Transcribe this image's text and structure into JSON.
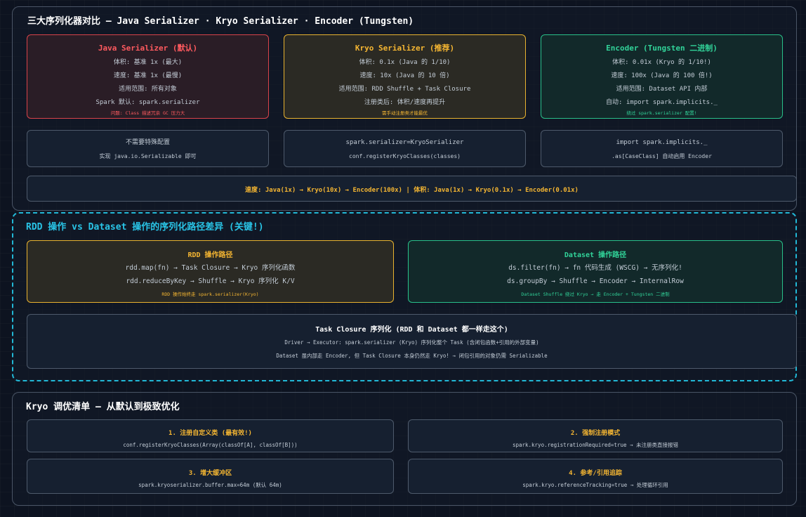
{
  "section1": {
    "title": "三大序列化器对比 — Java Serializer · Kryo Serializer · Encoder (Tungsten)",
    "java": {
      "title": "Java Serializer (默认)",
      "lines": [
        "体积: 基准 1x (最大)",
        "速度: 基准 1x (最慢)",
        "适用范围: 所有对象",
        "Spark 默认: spark.serializer"
      ],
      "note": "问题: Class 描述冗余 GC 压力大"
    },
    "kryo": {
      "title": "Kryo Serializer (推荐)",
      "lines": [
        "体积: 0.1x (Java 的 1/10)",
        "速度: 10x (Java 的 10 倍)",
        "适用范围: RDD Shuffle + Task Closure",
        "注册类后: 体积/速度再提升"
      ],
      "note": "需手动注册类才能最优"
    },
    "encoder": {
      "title": "Encoder (Tungsten 二进制)",
      "lines": [
        "体积: 0.01x (Kryo 的 1/10!)",
        "速度: 100x (Java 的 100 倍!)",
        "适用范围: Dataset API 内部",
        "自动: import spark.implicits._"
      ],
      "note": "绕过 spark.serializer 配置!"
    },
    "config_java": {
      "line1": "不需要特殊配置",
      "line2": "实现 java.io.Serializable 即可"
    },
    "config_kryo": {
      "line1": "spark.serializer=KryoSerializer",
      "line2": "conf.registerKryoClasses(classes)"
    },
    "config_encoder": {
      "line1": "import spark.implicits._",
      "line2": ".as[CaseClass] 自动启用 Encoder"
    },
    "summary": "速度: Java(1x) → Kryo(10x) → Encoder(100x) | 体积: Java(1x) → Kryo(0.1x) → Encoder(0.01x)"
  },
  "section2": {
    "title": "RDD 操作 vs Dataset 操作的序列化路径差异 (关键!)",
    "rdd": {
      "title": "RDD 操作路径",
      "lines": [
        "rdd.map(fn) → Task Closure → Kryo 序列化函数",
        "rdd.reduceByKey → Shuffle → Kryo 序列化 K/V"
      ],
      "note": "RDD 操作始终走 spark.serializer(Kryo)"
    },
    "dataset": {
      "title": "Dataset 操作路径",
      "lines": [
        "ds.filter(fn) → fn 代码生成 (WSCG) → 无序列化!",
        "ds.groupBy → Shuffle → Encoder → InternalRow"
      ],
      "note": "Dataset Shuffle 绕过 Kryo → 走 Encoder + Tungsten 二进制"
    },
    "closure": {
      "title": "Task Closure 序列化 (RDD 和 Dataset 都一样走这个)",
      "line1": "Driver → Executor: spark.serializer (Kryo) 序列化整个 Task (含闭包函数+引用的外部变量)",
      "line2": "Dataset 虽内部走 Encoder, 但 Task Closure 本身仍然走 Kryo! → 闭包引用的对象仍需 Serializable"
    }
  },
  "section3": {
    "title": "Kryo 调优清单 — 从默认到极致优化",
    "items": [
      {
        "title": "1. 注册自定义类 (最有效!)",
        "line": "conf.registerKryoClasses(Array(classOf[A], classOf[B]))"
      },
      {
        "title": "2. 强制注册模式",
        "line": "spark.kryo.registrationRequired=true → 未注册类直接报错"
      },
      {
        "title": "3. 增大缓冲区",
        "line": "spark.kryoserializer.buffer.max=64m (默认 64m)"
      },
      {
        "title": "4. 参考/引用追踪",
        "line": "spark.kryo.referenceTracking=true → 处理循环引用"
      }
    ]
  }
}
